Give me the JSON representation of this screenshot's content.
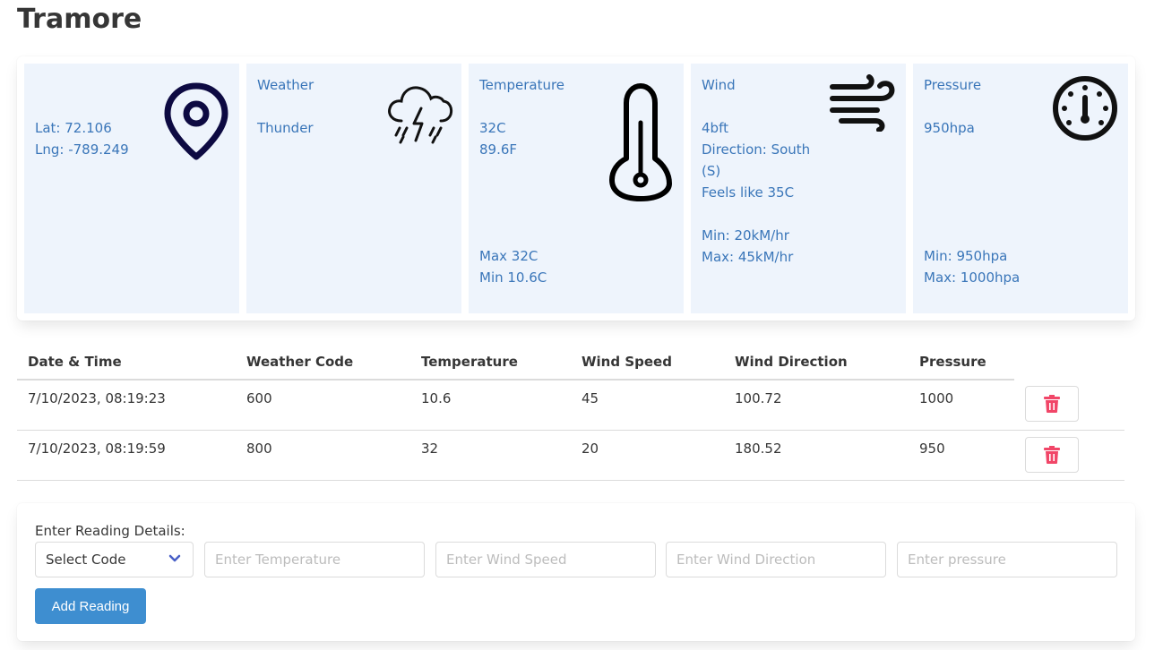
{
  "page": {
    "title": "Tramore"
  },
  "cards": {
    "location": {
      "lat": "Lat: 72.106",
      "lng": "Lng: -789.249"
    },
    "weather": {
      "heading": "Weather",
      "condition": "Thunder"
    },
    "temperature": {
      "heading": "Temperature",
      "celsius": "32C",
      "fahrenheit": "89.6F",
      "max": "Max 32C",
      "min": "Min 10.6C"
    },
    "wind": {
      "heading": "Wind",
      "speed": "4bft",
      "direction_line1": "Direction: South",
      "direction_line2": "(S)",
      "feels_like": "Feels like 35C",
      "min": "Min: 20kM/hr",
      "max": "Max: 45kM/hr"
    },
    "pressure": {
      "heading": "Pressure",
      "value": "950hpa",
      "min": "Min: 950hpa",
      "max": "Max: 1000hpa"
    }
  },
  "table": {
    "headers": [
      "Date & Time",
      "Weather Code",
      "Temperature",
      "Wind Speed",
      "Wind Direction",
      "Pressure"
    ],
    "rows": [
      [
        "7/10/2023, 08:19:23",
        "600",
        "10.6",
        "45",
        "100.72",
        "1000"
      ],
      [
        "7/10/2023, 08:19:59",
        "800",
        "32",
        "20",
        "180.52",
        "950"
      ]
    ]
  },
  "form": {
    "label": "Enter Reading Details:",
    "select_value": "Select Code",
    "temperature_placeholder": "Enter Temperature",
    "wind_speed_placeholder": "Enter Wind Speed",
    "wind_direction_placeholder": "Enter Wind Direction",
    "pressure_placeholder": "Enter pressure",
    "add_button": "Add Reading"
  },
  "colors": {
    "card_bg": "#eef4fc",
    "card_text": "#3a76b9",
    "danger": "#f14668",
    "primary": "#3e8ed0",
    "location_icon": "#0d0a42"
  },
  "icons": [
    "map-pin-icon",
    "thunderstorm-icon",
    "thermometer-icon",
    "wind-icon",
    "gauge-icon",
    "trash-icon",
    "chevron-down-icon"
  ]
}
